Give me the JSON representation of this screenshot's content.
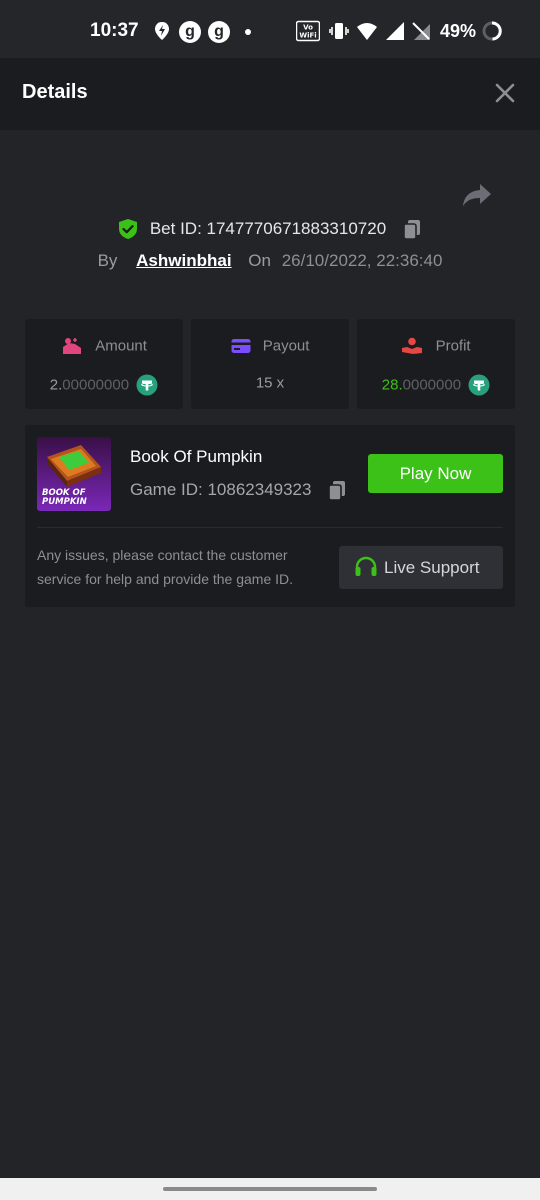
{
  "status_bar": {
    "time": "10:37",
    "g1": "g",
    "g2": "g",
    "battery": "49%",
    "volte_top": "Vo",
    "volte_bottom": "WiFi"
  },
  "header": {
    "title": "Details"
  },
  "bet": {
    "id_label": "Bet ID: 1747770671883310720",
    "by_label": "By",
    "user": "Ashwinbhai",
    "on_label": "On",
    "date": "26/10/2022, 22:36:40"
  },
  "stats": {
    "amount": {
      "label": "Amount",
      "value_main": "2.",
      "value_dim": "00000000"
    },
    "payout": {
      "label": "Payout",
      "value": "15 x"
    },
    "profit": {
      "label": "Profit",
      "value_main": "28.",
      "value_dim": "0000000"
    }
  },
  "game": {
    "name": "Book Of Pumpkin",
    "id_label": "Game ID: 10862349323",
    "play_label": "Play Now",
    "thumb_text_1": "BOOK OF",
    "thumb_text_2": "PUMPKIN"
  },
  "support": {
    "help_text": "Any issues, please contact the customer service for help and provide the game ID.",
    "button_label": "Live Support"
  },
  "colors": {
    "accent_green": "#3bc117",
    "background": "#232428",
    "panel": "#1b1c1f",
    "tether": "#26a17b",
    "amount_icon": "#e0457b",
    "payout_icon": "#7b4dff",
    "profit_icon": "#e84545"
  }
}
